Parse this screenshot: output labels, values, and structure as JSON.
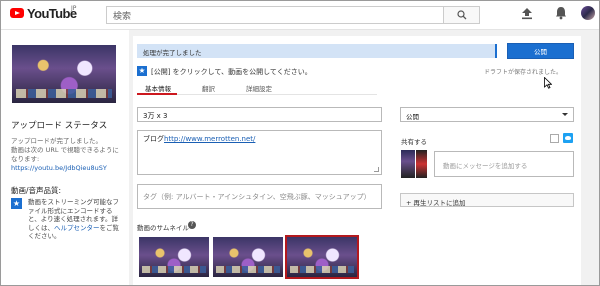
{
  "header": {
    "logo_text": "YouTube",
    "logo_region": "JP",
    "search_placeholder": "検索"
  },
  "sidebar": {
    "status_title": "アップロード ステータス",
    "status_message": "アップロードが完了しました。",
    "url_label": "動画は次の URL で視聴できるようになります:",
    "url": "https://youtu.be/JdbQieu8uSY",
    "quality_title": "動画/音声品質:",
    "quality_text": "動画をストリーミング可能なファイル形式にエンコードすると、より速く処理されます。詳しくは、",
    "help_link": "ヘルプセンター",
    "quality_text_end": "をご覧ください。"
  },
  "main": {
    "progress_text": "処理が完了しました",
    "publish_label": "公開",
    "message": "[公開] をクリックして、動画を公開してください。",
    "draft_status": "ドラフトが保存されました。",
    "tabs": [
      {
        "label": "基本情報",
        "active": true
      },
      {
        "label": "翻訳",
        "active": false
      },
      {
        "label": "詳細設定",
        "active": false
      }
    ],
    "title_value": "3万 x 3",
    "description_prefix": "ブログ",
    "description_url": "http://www.merrotten.net/",
    "tags_placeholder": "タグ（例: アルバート・アインシュタイン、空飛ぶ豚、マッシュアップ）",
    "thumbnails_label": "動画のサムネイル",
    "thumbnails_selected_index": 2
  },
  "right": {
    "privacy_value": "公開",
    "share_label": "共有する",
    "share_placeholder": "動画にメッセージを追加する",
    "playlist_label": "+ 再生リストに追加"
  },
  "colors": {
    "accent": "#1b6fd0",
    "youtube_red": "#ff0000",
    "progress_bg": "#d3e3f6",
    "tab_underline": "#cc181e"
  },
  "icons": [
    "youtube-logo-icon",
    "search-icon",
    "upload-icon",
    "bell-icon",
    "info-icon",
    "help-icon",
    "twitter-icon",
    "chevron-down-icon"
  ]
}
